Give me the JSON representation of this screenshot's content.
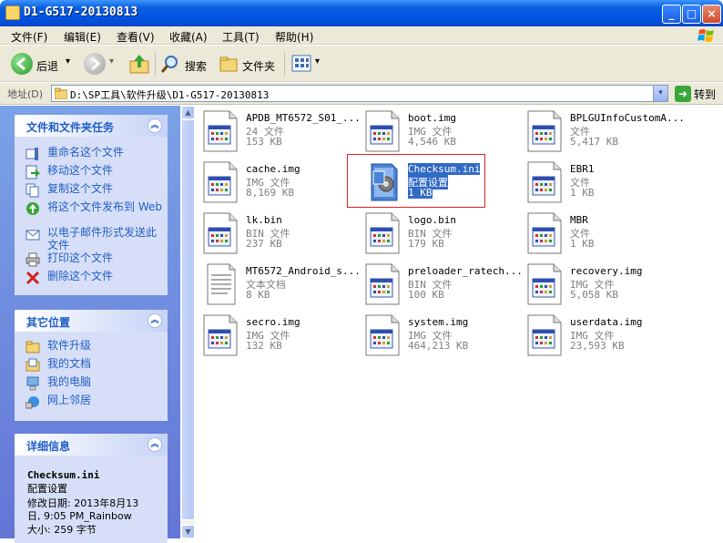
{
  "window": {
    "title": "D1-G517-20130813",
    "minimize": "_",
    "maximize": "□",
    "close": "×"
  },
  "menu": [
    "文件(F)",
    "编辑(E)",
    "查看(V)",
    "收藏(A)",
    "工具(T)",
    "帮助(H)"
  ],
  "toolbar": {
    "back": "后退",
    "search": "搜索",
    "folders": "文件夹",
    "back_dropdown": "▾",
    "views_dropdown": "▾"
  },
  "address": {
    "label": "地址(D)",
    "value": "D:\\SP工具\\软件升级\\D1-G517-20130813",
    "go": "转到",
    "dropdown": "▾"
  },
  "tasks_panel": {
    "title": "文件和文件夹任务",
    "toggle": "︽",
    "items": [
      {
        "label": "重命名这个文件",
        "icon": "rename-icon"
      },
      {
        "label": "移动这个文件",
        "icon": "move-icon"
      },
      {
        "label": "复制这个文件",
        "icon": "copy-icon"
      },
      {
        "label": "将这个文件发布到 Web",
        "icon": "publish-web-icon"
      },
      {
        "label": "以电子邮件形式发送此文件",
        "icon": "email-icon"
      },
      {
        "label": "打印这个文件",
        "icon": "print-icon"
      },
      {
        "label": "删除这个文件",
        "icon": "delete-icon"
      }
    ]
  },
  "places_panel": {
    "title": "其它位置",
    "toggle": "︽",
    "items": [
      {
        "label": "软件升级",
        "icon": "folder-icon"
      },
      {
        "label": "我的文档",
        "icon": "my-documents-icon"
      },
      {
        "label": "我的电脑",
        "icon": "my-computer-icon"
      },
      {
        "label": "网上邻居",
        "icon": "network-icon"
      }
    ]
  },
  "details_panel": {
    "title": "详细信息",
    "toggle": "︽",
    "file_name": "Checksum.ini",
    "file_type": "配置设置",
    "modified_line1": "修改日期: 2013年8月13",
    "modified_line2": "日, 9:05 PM_Rainbow",
    "size": "大小: 259 字节"
  },
  "scrollbar": {
    "up": "▲",
    "down": "▼"
  },
  "files": [
    {
      "name": "APDB_MT6572_S01_...",
      "type": "24 文件",
      "size": "153 KB",
      "icon": "generic-file-icon"
    },
    {
      "name": "boot.img",
      "type": "IMG 文件",
      "size": "4,546 KB",
      "icon": "generic-file-icon"
    },
    {
      "name": "BPLGUInfoCustomA...",
      "type": "文件",
      "size": "5,417 KB",
      "icon": "generic-file-icon"
    },
    {
      "name": "cache.img",
      "type": "IMG 文件",
      "size": "8,169 KB",
      "icon": "generic-file-icon"
    },
    {
      "name": "Checksum.ini",
      "type": "配置设置",
      "size": "1 KB",
      "icon": "config-settings-icon",
      "selected": true
    },
    {
      "name": "EBR1",
      "type": "文件",
      "size": "1 KB",
      "icon": "generic-file-icon"
    },
    {
      "name": "lk.bin",
      "type": "BIN 文件",
      "size": "237 KB",
      "icon": "generic-file-icon"
    },
    {
      "name": "logo.bin",
      "type": "BIN 文件",
      "size": "179 KB",
      "icon": "generic-file-icon"
    },
    {
      "name": "MBR",
      "type": "文件",
      "size": "1 KB",
      "icon": "generic-file-icon"
    },
    {
      "name": "MT6572_Android_s...",
      "type": "文本文档",
      "size": "8 KB",
      "icon": "text-document-icon"
    },
    {
      "name": "preloader_ratech...",
      "type": "BIN 文件",
      "size": "100 KB",
      "icon": "generic-file-icon"
    },
    {
      "name": "recovery.img",
      "type": "IMG 文件",
      "size": "5,058 KB",
      "icon": "generic-file-icon"
    },
    {
      "name": "secro.img",
      "type": "IMG 文件",
      "size": "132 KB",
      "icon": "generic-file-icon"
    },
    {
      "name": "system.img",
      "type": "IMG 文件",
      "size": "464,213 KB",
      "icon": "generic-file-icon"
    },
    {
      "name": "userdata.img",
      "type": "IMG 文件",
      "size": "23,593 KB",
      "icon": "generic-file-icon"
    }
  ]
}
